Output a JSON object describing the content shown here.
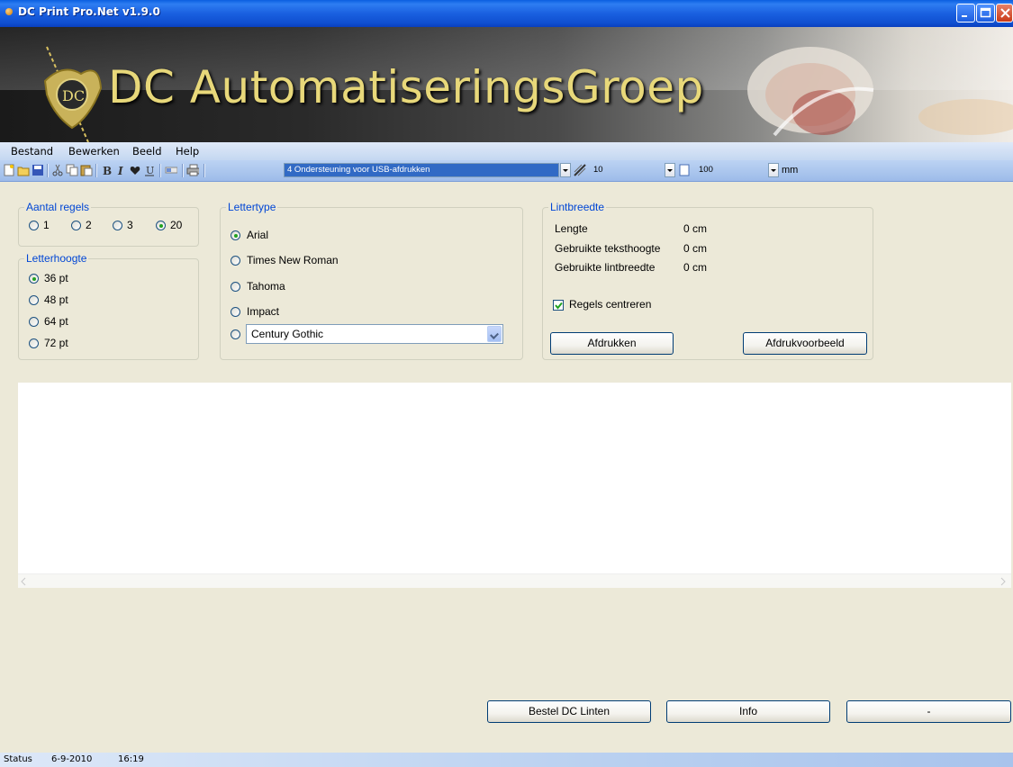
{
  "window": {
    "title": "DC Print Pro.Net v1.9.0"
  },
  "banner": {
    "company": "DC AutomatiseringsGroep"
  },
  "menu": [
    "Bestand",
    "Bewerken",
    "Beeld",
    "Help"
  ],
  "toolbar": {
    "printer": "4 Ondersteuning voor USB-afdrukken",
    "thickness": "10",
    "size": "100",
    "unit": "mm",
    "icons": [
      "new-icon",
      "open-icon",
      "save-icon",
      "cut-icon",
      "copy-icon",
      "paste-icon",
      "bold-icon",
      "italic-icon",
      "heart-icon",
      "underline-icon",
      "toggle-icon",
      "print-icon"
    ]
  },
  "aantal_regels": {
    "legend": "Aantal regels",
    "options": [
      "1",
      "2",
      "3",
      "20"
    ],
    "selected": "20"
  },
  "letterhoogte": {
    "legend": "Letterhoogte",
    "options": [
      "36 pt",
      "48 pt",
      "64 pt",
      "72 pt"
    ],
    "selected": "36 pt"
  },
  "lettertype": {
    "legend": "Lettertype",
    "options": [
      "Arial",
      "Times New Roman",
      "Tahoma",
      "Impact"
    ],
    "selected": "Arial",
    "custom_font": "Century Gothic"
  },
  "lintbreedte": {
    "legend": "Lintbreedte",
    "rows": [
      {
        "label": "Lengte",
        "value": "0 cm"
      },
      {
        "label": "Gebruikte teksthoogte",
        "value": "0 cm"
      },
      {
        "label": "Gebruikte lintbreedte",
        "value": "0 cm"
      }
    ],
    "center_label": "Regels centreren",
    "center_checked": true,
    "print_button": "Afdrukken",
    "preview_button": "Afdrukvoorbeeld"
  },
  "bottom_buttons": {
    "order": "Bestel DC Linten",
    "info": "Info",
    "third": "-"
  },
  "statusbar": {
    "label": "Status",
    "date": "6-9-2010",
    "time": "16:19"
  },
  "colors": {
    "xp_blue": "#0A5FE0",
    "legend_blue": "#0046D5",
    "banner_gold": "#E8D87A",
    "selection": "#316AC5"
  }
}
